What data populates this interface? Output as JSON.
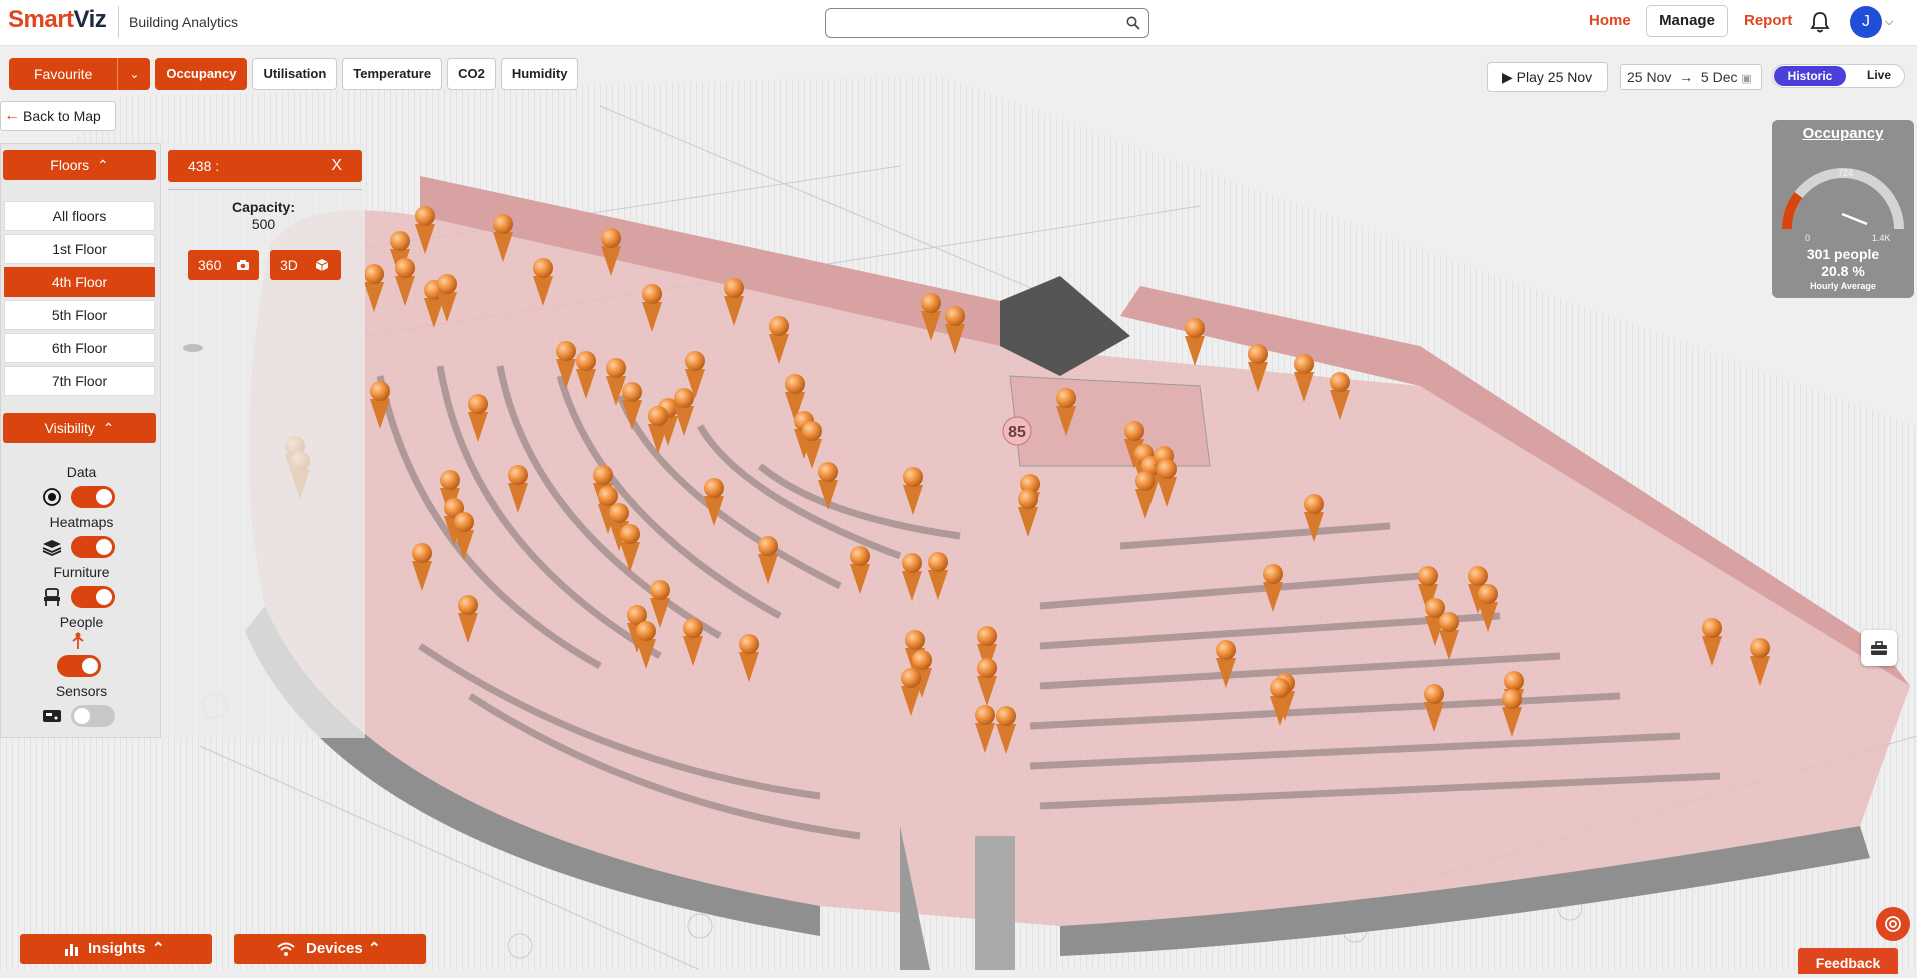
{
  "header": {
    "brand_part1": "Smart",
    "brand_part2": "Viz",
    "subtitle": "Building Analytics",
    "search_value": "",
    "nav": {
      "home": "Home",
      "manage": "Manage",
      "report": "Report"
    },
    "avatar_initial": "J"
  },
  "toolbar": {
    "favourite": "Favourite",
    "tabs": [
      "Occupancy",
      "Utilisation",
      "Temperature",
      "CO2",
      "Humidity"
    ],
    "active_tab": "Occupancy",
    "play": "Play 25 Nov",
    "date_from": "25 Nov",
    "date_to": "5 Dec",
    "mode_historic": "Historic",
    "mode_live": "Live"
  },
  "back_label": "Back to Map",
  "floors": {
    "header": "Floors",
    "items": [
      "All floors",
      "1st Floor",
      "4th Floor",
      "5th Floor",
      "6th Floor",
      "7th Floor"
    ],
    "selected": "4th Floor"
  },
  "visibility": {
    "header": "Visibility",
    "items": [
      {
        "label": "Data",
        "on": true
      },
      {
        "label": "Heatmaps",
        "on": true
      },
      {
        "label": "Furniture",
        "on": true
      },
      {
        "label": "People",
        "on": true
      },
      {
        "label": "Sensors",
        "on": false
      }
    ]
  },
  "room": {
    "title": "438 :",
    "close": "X",
    "capacity_label": "Capacity:",
    "capacity_value": "500",
    "btn_360": "360",
    "btn_3d": "3D"
  },
  "scene": {
    "marker_label": "85"
  },
  "occupancy": {
    "title": "Occupancy",
    "tick_min": "0",
    "tick_mid": "724",
    "tick_max": "1.4K",
    "people": "301 people",
    "percent": "20.8 %",
    "caption": "Hourly Average",
    "value_fraction": 0.208
  },
  "bottom": {
    "insights": "Insights",
    "devices": "Devices",
    "feedback": "Feedback"
  },
  "colors": {
    "accent": "#d9440f",
    "brand": "#e0461e",
    "historic": "#4b3fd9",
    "avatar": "#1e4fd6"
  }
}
